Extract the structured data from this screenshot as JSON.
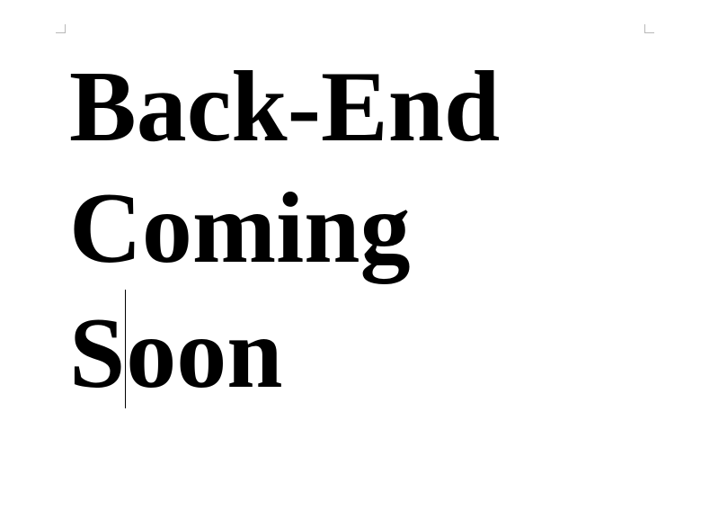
{
  "document": {
    "lines": {
      "line1": "Back-End",
      "line2": "Coming",
      "line3_before_caret": "S",
      "line3_after_caret": "oon"
    }
  }
}
